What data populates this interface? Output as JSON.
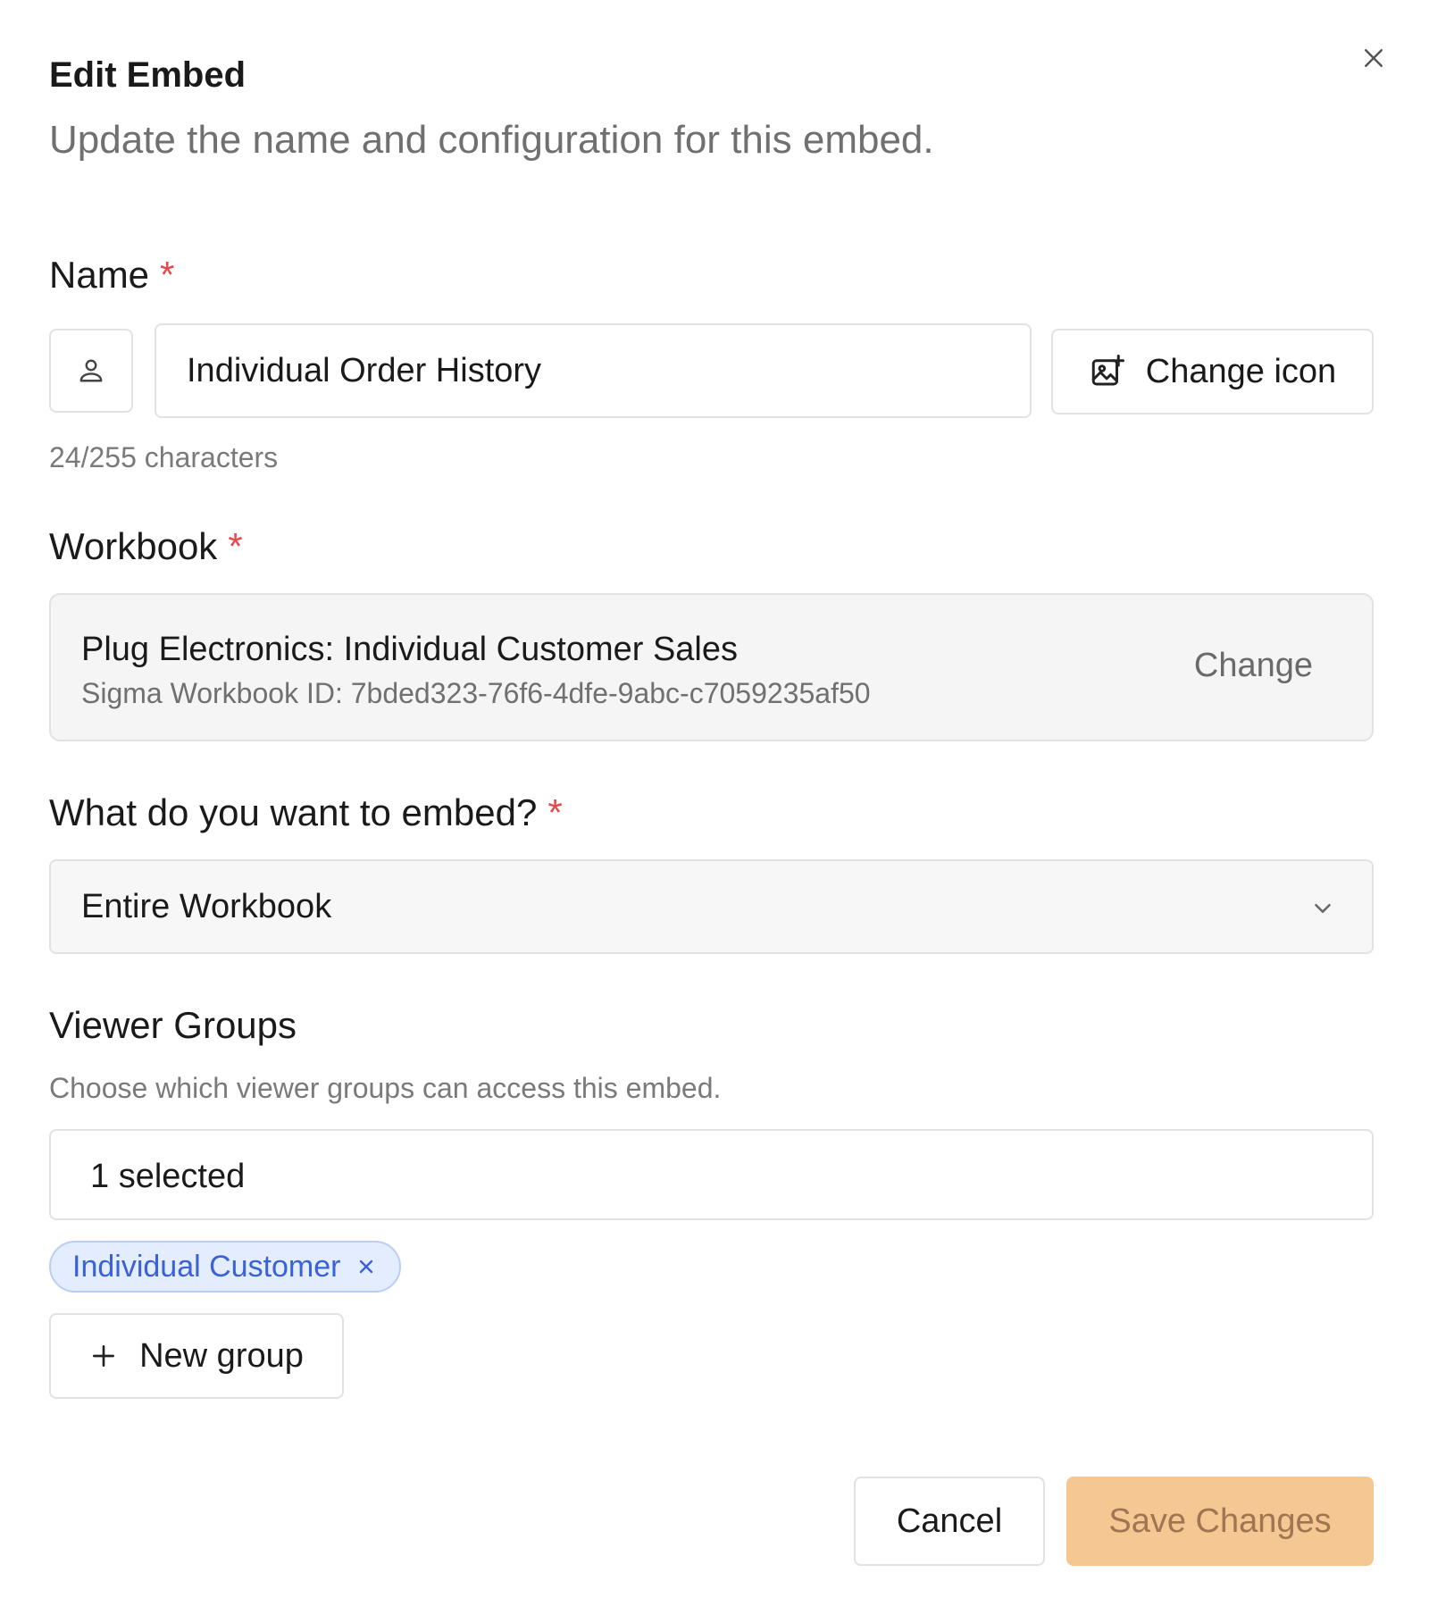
{
  "dialog": {
    "title": "Edit Embed",
    "subtitle": "Update the name and configuration for this embed.",
    "close_icon": "close-icon"
  },
  "name_field": {
    "label": "Name",
    "required_mark": "*",
    "icon": "user-icon",
    "value": "Individual Order History",
    "char_count": "24/255 characters",
    "change_icon_label": "Change icon",
    "change_icon_icon": "image-plus-icon"
  },
  "workbook_field": {
    "label": "Workbook",
    "required_mark": "*",
    "workbook_name": "Plug Electronics: Individual Customer Sales",
    "workbook_id": "Sigma Workbook ID: 7bded323-76f6-4dfe-9abc-c7059235af50",
    "change_label": "Change"
  },
  "embed_target_field": {
    "label": "What do you want to embed?",
    "required_mark": "*",
    "selected": "Entire Workbook",
    "icon": "chevron-down-icon"
  },
  "viewer_groups": {
    "label": "Viewer Groups",
    "help_text": "Choose which viewer groups can access this embed.",
    "summary": "1 selected",
    "chips": [
      {
        "label": "Individual Customer"
      }
    ],
    "new_group_label": "New group"
  },
  "footer": {
    "cancel_label": "Cancel",
    "save_label": "Save Changes"
  },
  "colors": {
    "required": "#e5484d",
    "chip_bg": "#e4edfd",
    "chip_text": "#3a62d6",
    "save_bg": "#f5c792",
    "save_text": "#a07652"
  }
}
